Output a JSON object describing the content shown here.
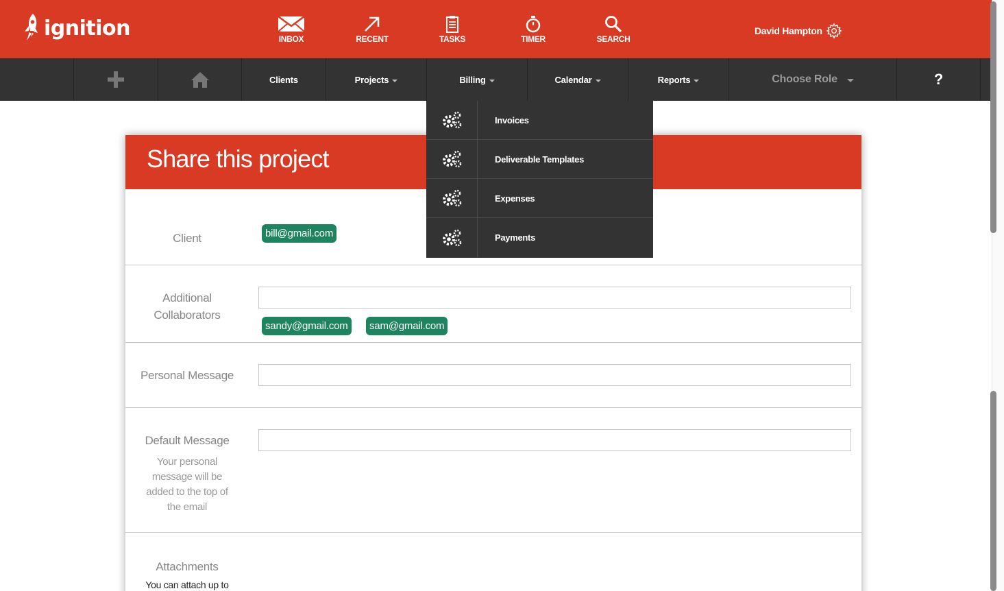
{
  "brand": {
    "name": "ignition"
  },
  "top_nav": [
    {
      "label": "INBOX",
      "icon": "envelope-icon"
    },
    {
      "label": "RECENT",
      "icon": "arrow-up-right-icon"
    },
    {
      "label": "TASKS",
      "icon": "clipboard-icon"
    },
    {
      "label": "TIMER",
      "icon": "stopwatch-icon"
    },
    {
      "label": "SEARCH",
      "icon": "search-icon"
    }
  ],
  "user": {
    "name": "David Hampton",
    "icon": "gear-icon"
  },
  "nav": {
    "add_icon": "plus-icon",
    "home_icon": "home-icon",
    "clients": "Clients",
    "projects": "Projects",
    "billing": "Billing",
    "calendar": "Calendar",
    "reports": "Reports",
    "choose_role": "Choose Role",
    "help": "?"
  },
  "billing_menu": [
    {
      "label": "Invoices",
      "icon": "gears-icon"
    },
    {
      "label": "Deliverable Templates",
      "icon": "gears-icon"
    },
    {
      "label": "Expenses",
      "icon": "gears-icon"
    },
    {
      "label": "Payments",
      "icon": "gears-icon"
    }
  ],
  "form": {
    "title": "Share this project",
    "client_label": "Client",
    "client_tag": "bill@gmail.com",
    "collab_label_1": "Additional",
    "collab_label_2": "Collaborators",
    "collab_value": "",
    "collab_tags": [
      "sandy@gmail.com",
      "sam@gmail.com"
    ],
    "personal_label": "Personal Message",
    "personal_value": "",
    "default_label": "Default Message",
    "default_help": [
      "Your personal",
      "message will be",
      "added to the top of",
      "the email"
    ],
    "default_value": "",
    "attachments_label": "Attachments",
    "attachments_help": "You can attach up to"
  },
  "colors": {
    "brand_red": "#d93a23",
    "nav_dark": "#333333",
    "tag_green": "#1e8460"
  }
}
